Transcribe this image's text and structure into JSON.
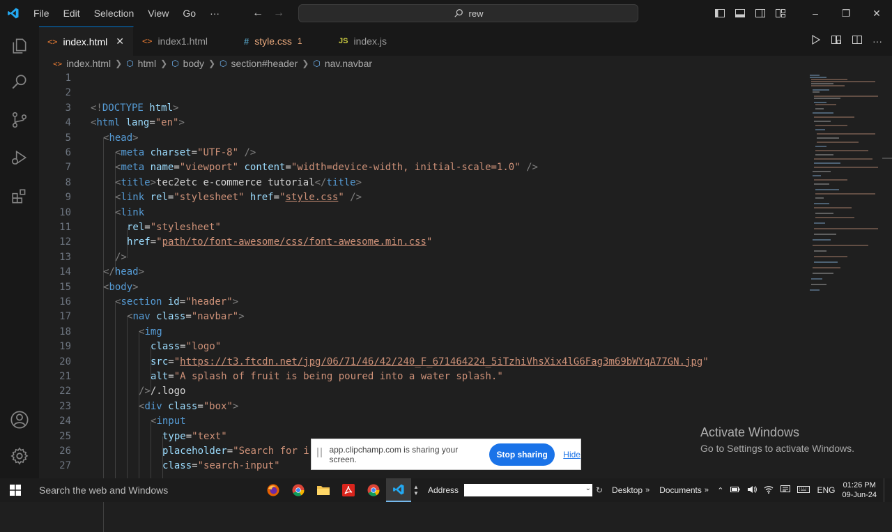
{
  "titlebar": {
    "menu": [
      "File",
      "Edit",
      "Selection",
      "View",
      "Go",
      "···"
    ],
    "search": "rew"
  },
  "tabs": [
    {
      "name": "index.html",
      "icon": "html",
      "active": true
    },
    {
      "name": "index1.html",
      "icon": "html",
      "active": false
    },
    {
      "name": "style.css",
      "icon": "css",
      "active": false,
      "problems": "1"
    },
    {
      "name": "index.js",
      "icon": "js",
      "active": false
    }
  ],
  "tab_icons": {
    "css": "#",
    "js": "JS",
    "html": "<>"
  },
  "breadcrumb": [
    "index.html",
    "html",
    "body",
    "section#header",
    "nav.navbar"
  ],
  "line_numbers": [
    "1",
    "2",
    "3",
    "4",
    "5",
    "6",
    "7",
    "8",
    "9",
    "10",
    "11",
    "12",
    "13",
    "14",
    "15",
    "16",
    "17",
    "18",
    "19",
    "20",
    "21",
    "22",
    "23",
    "24",
    "25",
    "26",
    "27"
  ],
  "code": {
    "l3": [
      "<!",
      "DOCTYPE",
      " html",
      ">"
    ],
    "l4": [
      "<",
      "html",
      " lang",
      "=",
      "\"en\"",
      ">"
    ],
    "l5": [
      "<",
      "head",
      ">"
    ],
    "l6": [
      "<",
      "meta",
      " charset",
      "=",
      "\"UTF-8\"",
      " />"
    ],
    "l7": [
      "<",
      "meta",
      " name",
      "=",
      "\"viewport\"",
      " content",
      "=",
      "\"width=device-width, initial-scale=1.0\"",
      " />"
    ],
    "l8": [
      "<",
      "title",
      ">",
      "tec2etc e-commerce tutorial",
      "</",
      "title",
      ">"
    ],
    "l9a": [
      "<",
      "link",
      " rel",
      "=",
      "\"stylesheet\"",
      " href",
      "=",
      "\""
    ],
    "l9b": "style.css",
    "l9c": [
      "\"",
      " />"
    ],
    "l10": [
      "<",
      "link"
    ],
    "l11": [
      "rel",
      "=",
      "\"stylesheet\""
    ],
    "l12a": [
      "href",
      "=",
      "\""
    ],
    "l12b": "path/to/font-awesome/css/font-awesome.min.css",
    "l12c": "\"",
    "l13": "/>",
    "l14": [
      "</",
      "head",
      ">"
    ],
    "l15": [
      "<",
      "body",
      ">"
    ],
    "l16": [
      "<",
      "section",
      " id",
      "=",
      "\"header\"",
      ">"
    ],
    "l17": [
      "<",
      "nav",
      " class",
      "=",
      "\"navbar\"",
      ">"
    ],
    "l18": [
      "<",
      "img"
    ],
    "l19": [
      "class",
      "=",
      "\"logo\""
    ],
    "l20a": [
      "src",
      "=",
      "\""
    ],
    "l20b": "https://t3.ftcdn.net/jpg/06/71/46/42/240_F_671464224_5iTzhiVhsXix4lG6Fag3m69bWYqA77GN.jpg",
    "l20c": "\"",
    "l21": [
      "alt",
      "=",
      "\"A splash of fruit is being poured into a water splash.\""
    ],
    "l22": [
      "/>",
      "/.logo"
    ],
    "l23": [
      "<",
      "div",
      " class",
      "=",
      "\"box\"",
      ">"
    ],
    "l24": [
      "<",
      "input"
    ],
    "l25": [
      "type",
      "=",
      "\"text\""
    ],
    "l26": [
      "placeholder",
      "=",
      "\"Search for i"
    ],
    "l27": [
      "class",
      "=",
      "\"search-input\""
    ]
  },
  "watermark": {
    "title": "Activate Windows",
    "subtitle": "Go to Settings to activate Windows."
  },
  "share_bar": {
    "message": "app.clipchamp.com is sharing your screen.",
    "stop": "Stop sharing",
    "hide": "Hide"
  },
  "taskbar": {
    "search": "Search the web and Windows",
    "address_label": "Address",
    "toolbars": [
      "Desktop",
      "Documents"
    ],
    "chevron": "»",
    "lang": "ENG",
    "time": "01:26 PM",
    "date": "09-Jun-24"
  },
  "colors": {
    "accent": "#0078d4",
    "tag": "#569cd6",
    "attr": "#9cdcfe",
    "string": "#ce9178",
    "vscode_blue": "#23a9f2"
  }
}
